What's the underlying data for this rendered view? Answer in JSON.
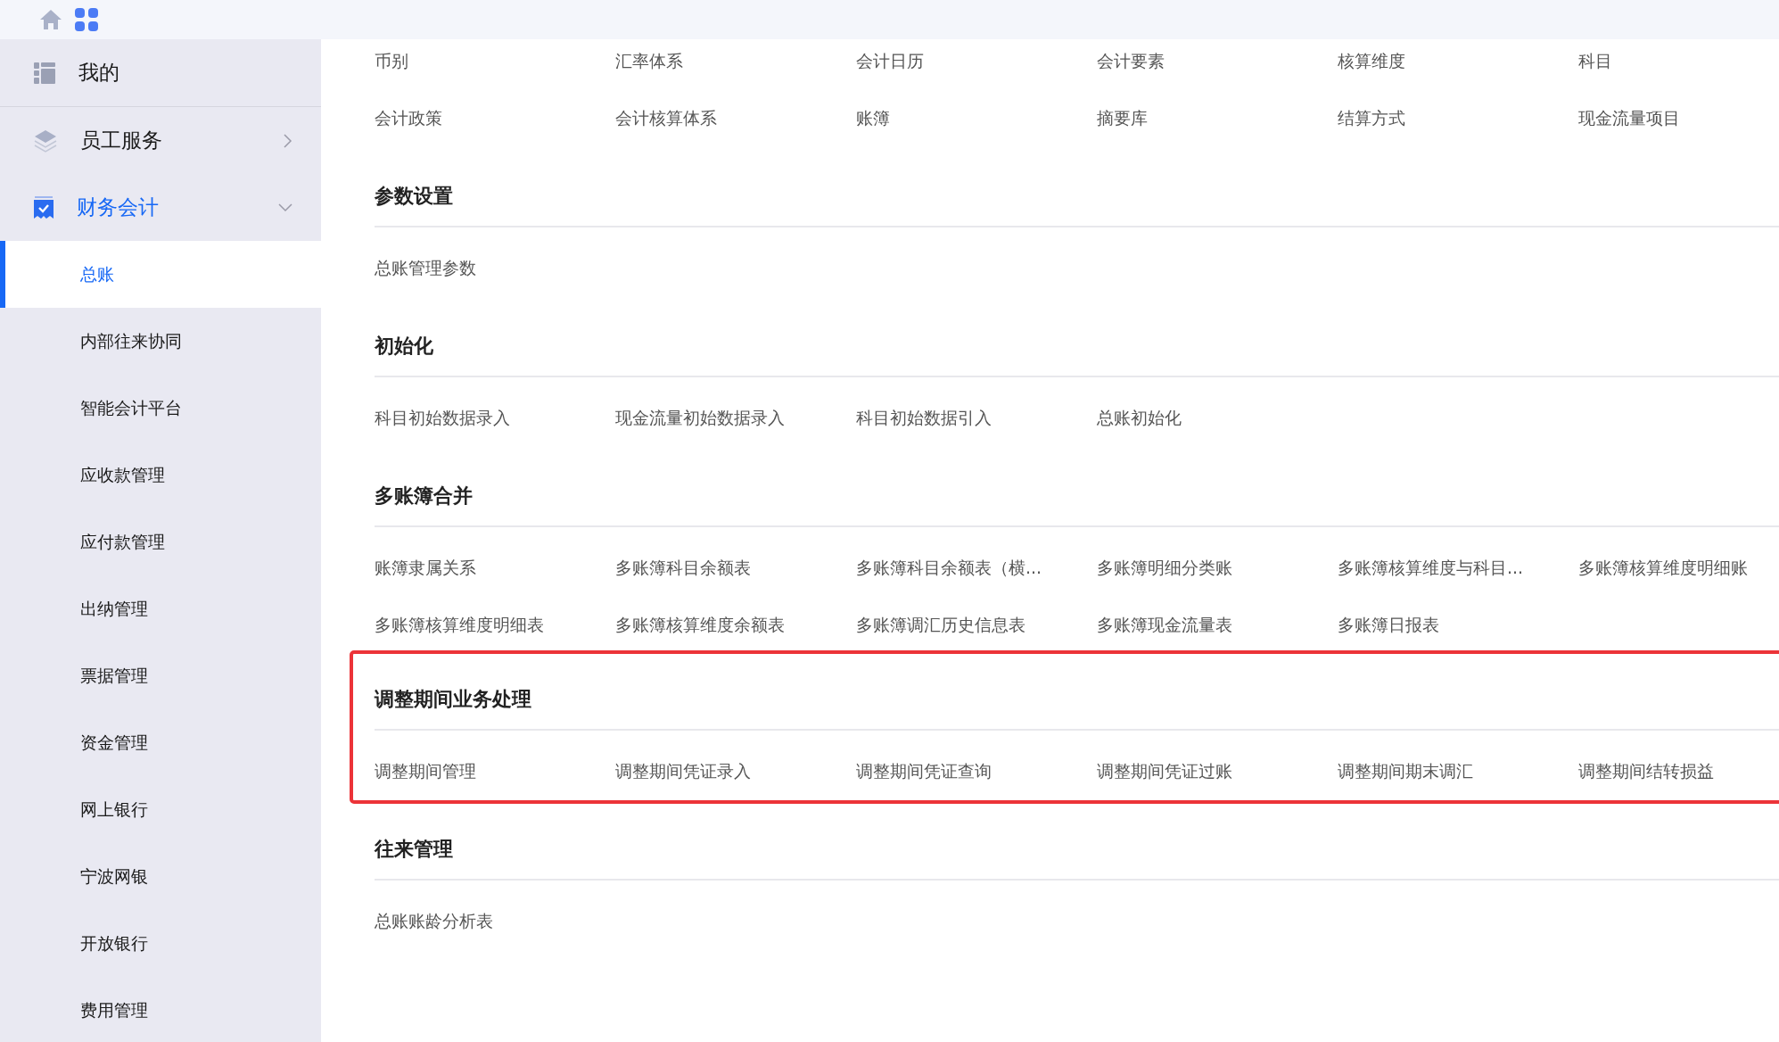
{
  "sidebar": {
    "groups": [
      {
        "label": "我的",
        "kind": "plain",
        "selected": false
      },
      {
        "label": "员工服务",
        "kind": "folder",
        "selected": false,
        "expanded": false
      },
      {
        "label": "财务会计",
        "kind": "folder",
        "selected": true,
        "expanded": true
      }
    ],
    "items": [
      {
        "label": "总账",
        "selected": true
      },
      {
        "label": "内部往来协同",
        "selected": false
      },
      {
        "label": "智能会计平台",
        "selected": false
      },
      {
        "label": "应收款管理",
        "selected": false
      },
      {
        "label": "应付款管理",
        "selected": false
      },
      {
        "label": "出纳管理",
        "selected": false
      },
      {
        "label": "票据管理",
        "selected": false
      },
      {
        "label": "资金管理",
        "selected": false
      },
      {
        "label": "网上银行",
        "selected": false
      },
      {
        "label": "宁波网银",
        "selected": false
      },
      {
        "label": "开放银行",
        "selected": false
      },
      {
        "label": "费用管理",
        "selected": false
      }
    ]
  },
  "sections": [
    {
      "highlighted": false,
      "items": [
        "币别",
        "汇率体系",
        "会计日历",
        "会计要素",
        "核算维度",
        "科目",
        "会计政策",
        "会计核算体系",
        "账簿",
        "摘要库",
        "结算方式",
        "现金流量项目"
      ]
    },
    {
      "title": "参数设置",
      "highlighted": false,
      "items": [
        "总账管理参数"
      ]
    },
    {
      "title": "初始化",
      "highlighted": false,
      "items": [
        "科目初始数据录入",
        "现金流量初始数据录入",
        "科目初始数据引入",
        "总账初始化"
      ]
    },
    {
      "title": "多账簿合并",
      "highlighted": false,
      "items": [
        "账簿隶属关系",
        "多账簿科目余额表",
        "多账簿科目余额表（横...",
        "多账簿明细分类账",
        "多账簿核算维度与科目...",
        "多账簿核算维度明细账",
        "多账簿核算维度明细表",
        "多账簿核算维度余额表",
        "多账簿调汇历史信息表",
        "多账簿现金流量表",
        "多账簿日报表"
      ]
    },
    {
      "title": "调整期间业务处理",
      "highlighted": true,
      "items": [
        "调整期间管理",
        "调整期间凭证录入",
        "调整期间凭证查询",
        "调整期间凭证过账",
        "调整期间期末调汇",
        "调整期间结转损益"
      ]
    },
    {
      "title": "往来管理",
      "highlighted": false,
      "items": [
        "总账账龄分析表"
      ]
    }
  ]
}
